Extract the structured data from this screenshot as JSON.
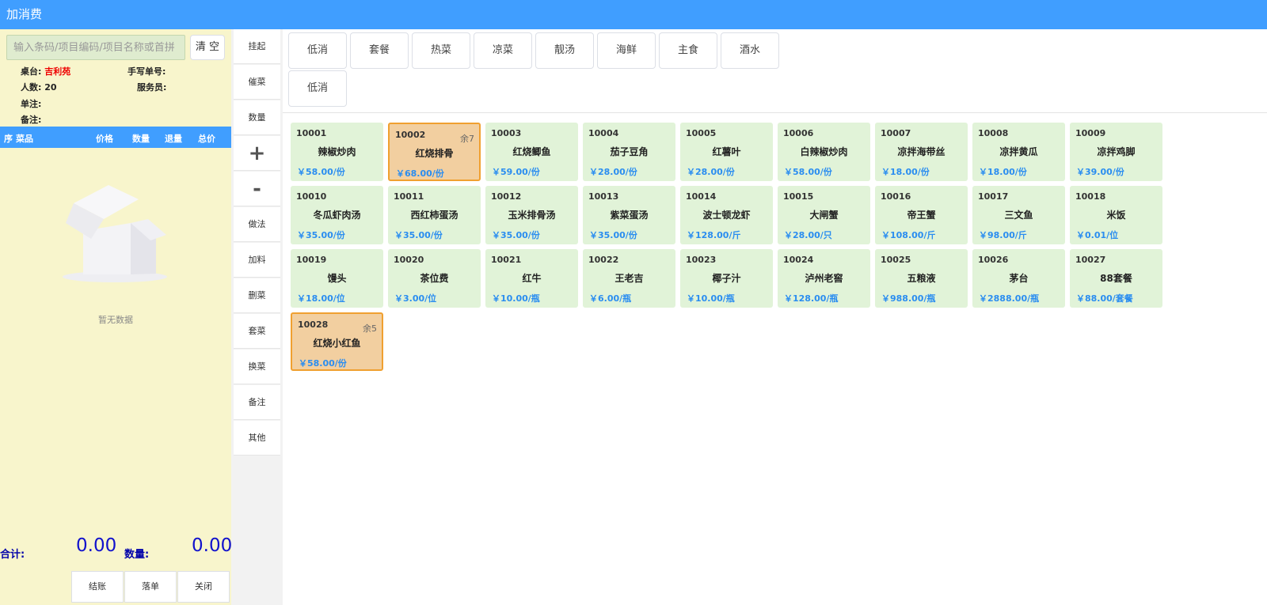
{
  "window": {
    "title": "加消费"
  },
  "search": {
    "placeholder": "输入条码/项目编码/项目名称或首拼",
    "clear_label": "清 空"
  },
  "info": {
    "table_label": "桌台:",
    "table_value": "吉利苑",
    "manual_label": "手写单号:",
    "people_label": "人数:",
    "people_value": "20",
    "waiter_label": "服务员:",
    "note_label": "单注:",
    "remark_label": "备注:"
  },
  "order_table": {
    "columns": [
      "序",
      "菜品",
      "价格",
      "数量",
      "退量",
      "总价"
    ],
    "rows": [],
    "empty_text": "暂无数据"
  },
  "summary": {
    "total_label": "合计:",
    "total_value": "0.00",
    "qty_label": "数量:",
    "qty_value": "0.00"
  },
  "bottom_buttons": [
    "结账",
    "落单",
    "关闭"
  ],
  "actions": [
    "挂起",
    "催菜",
    "数量",
    "+",
    "-",
    "做法",
    "加料",
    "删菜",
    "套菜",
    "换菜",
    "备注",
    "其他"
  ],
  "categories": [
    "低消",
    "套餐",
    "热菜",
    "凉菜",
    "靓汤",
    "海鲜",
    "主食",
    "酒水",
    "低消"
  ],
  "dishes": [
    {
      "code": "10001",
      "name": "辣椒炒肉",
      "price": "￥58.00/份",
      "remaining": "",
      "selected": false
    },
    {
      "code": "10002",
      "name": "红烧排骨",
      "price": "￥68.00/份",
      "remaining": "余7",
      "selected": true
    },
    {
      "code": "10003",
      "name": "红烧鲫鱼",
      "price": "￥59.00/份",
      "remaining": "",
      "selected": false
    },
    {
      "code": "10004",
      "name": "茄子豆角",
      "price": "￥28.00/份",
      "remaining": "",
      "selected": false
    },
    {
      "code": "10005",
      "name": "红薯叶",
      "price": "￥28.00/份",
      "remaining": "",
      "selected": false
    },
    {
      "code": "10006",
      "name": "白辣椒炒肉",
      "price": "￥58.00/份",
      "remaining": "",
      "selected": false
    },
    {
      "code": "10007",
      "name": "凉拌海带丝",
      "price": "￥18.00/份",
      "remaining": "",
      "selected": false
    },
    {
      "code": "10008",
      "name": "凉拌黄瓜",
      "price": "￥18.00/份",
      "remaining": "",
      "selected": false
    },
    {
      "code": "10009",
      "name": "凉拌鸡脚",
      "price": "￥39.00/份",
      "remaining": "",
      "selected": false
    },
    {
      "code": "10010",
      "name": "冬瓜虾肉汤",
      "price": "￥35.00/份",
      "remaining": "",
      "selected": false
    },
    {
      "code": "10011",
      "name": "西红柿蛋汤",
      "price": "￥35.00/份",
      "remaining": "",
      "selected": false
    },
    {
      "code": "10012",
      "name": "玉米排骨汤",
      "price": "￥35.00/份",
      "remaining": "",
      "selected": false
    },
    {
      "code": "10013",
      "name": "紫菜蛋汤",
      "price": "￥35.00/份",
      "remaining": "",
      "selected": false
    },
    {
      "code": "10014",
      "name": "波士顿龙虾",
      "price": "￥128.00/斤",
      "remaining": "",
      "selected": false
    },
    {
      "code": "10015",
      "name": "大闸蟹",
      "price": "￥28.00/只",
      "remaining": "",
      "selected": false
    },
    {
      "code": "10016",
      "name": "帝王蟹",
      "price": "￥108.00/斤",
      "remaining": "",
      "selected": false
    },
    {
      "code": "10017",
      "name": "三文鱼",
      "price": "￥98.00/斤",
      "remaining": "",
      "selected": false
    },
    {
      "code": "10018",
      "name": "米饭",
      "price": "￥0.01/位",
      "remaining": "",
      "selected": false
    },
    {
      "code": "10019",
      "name": "馒头",
      "price": "￥18.00/位",
      "remaining": "",
      "selected": false
    },
    {
      "code": "10020",
      "name": "茶位费",
      "price": "￥3.00/位",
      "remaining": "",
      "selected": false
    },
    {
      "code": "10021",
      "name": "红牛",
      "price": "￥10.00/瓶",
      "remaining": "",
      "selected": false
    },
    {
      "code": "10022",
      "name": "王老吉",
      "price": "￥6.00/瓶",
      "remaining": "",
      "selected": false
    },
    {
      "code": "10023",
      "name": "椰子汁",
      "price": "￥10.00/瓶",
      "remaining": "",
      "selected": false
    },
    {
      "code": "10024",
      "name": "泸州老窖",
      "price": "￥128.00/瓶",
      "remaining": "",
      "selected": false
    },
    {
      "code": "10025",
      "name": "五粮液",
      "price": "￥988.00/瓶",
      "remaining": "",
      "selected": false
    },
    {
      "code": "10026",
      "name": "茅台",
      "price": "￥2888.00/瓶",
      "remaining": "",
      "selected": false
    },
    {
      "code": "10027",
      "name": "88套餐",
      "price": "￥88.00/套餐",
      "remaining": "",
      "selected": false
    },
    {
      "code": "10028",
      "name": "红烧小红鱼",
      "price": "￥58.00/份",
      "remaining": "余5",
      "selected": true
    }
  ],
  "colors": {
    "brand": "#409eff",
    "panel": "#f8f5cc",
    "dish": "#e1f3d8",
    "dish_selected": "#f2cfa0",
    "price": "#2a8df0"
  }
}
